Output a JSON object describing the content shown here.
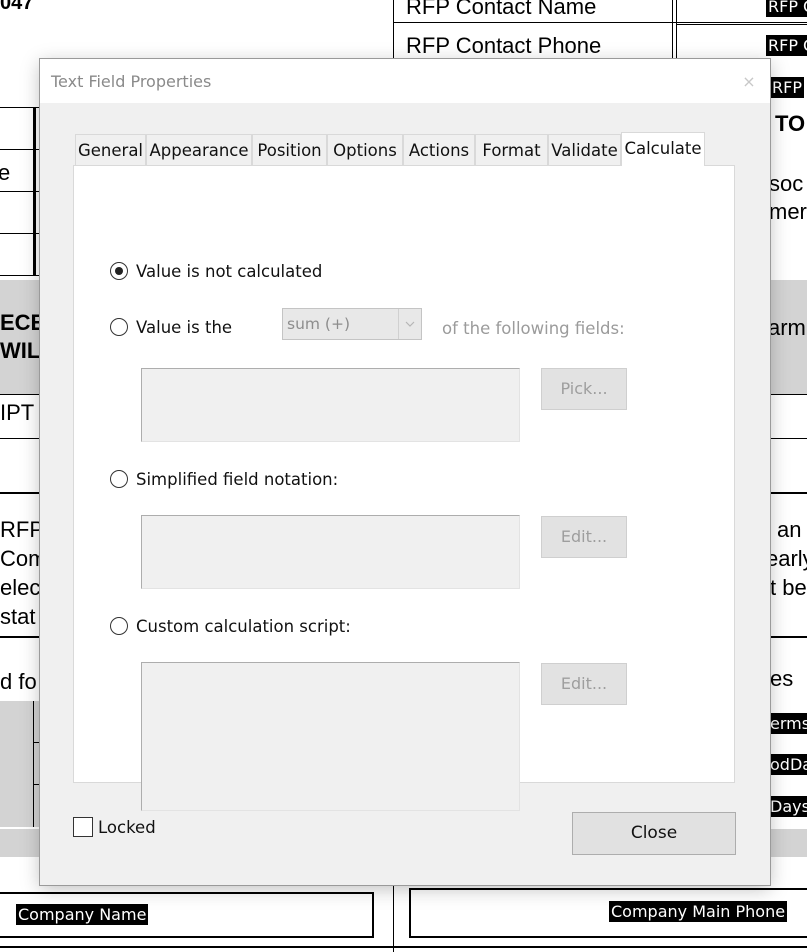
{
  "background_doc": {
    "top_left_number": "047",
    "rfp_contact_name": "RFP Contact Name",
    "rfp_contact_phone": "RFP Contact Phone",
    "field_rfp_1": "RFP C",
    "field_rfp_2": "RFP C",
    "field_rfp_3": "RFP",
    "right_to": "TO",
    "right_soc": "soc",
    "right_mer": "mer",
    "right_arm": "arm",
    "right_an": "l an",
    "right_early": "early",
    "right_tbe": "t be",
    "right_es": "es",
    "field_erms": "erms",
    "field_odda": "odDa",
    "field_days": "Days",
    "left_e": "e",
    "left_ece": "ECE",
    "left_will": "WILL",
    "left_ipt": "IPT",
    "left_rfp": "RFP",
    "left_com": "Com",
    "left_elect": "elect",
    "left_stat": "stat",
    "left_dfo": "d fo",
    "company_name": "Company Name",
    "company_main_phone": "Company Main Phone"
  },
  "dialog": {
    "title": "Text Field Properties",
    "close_glyph": "×",
    "tabs": [
      {
        "label": "General"
      },
      {
        "label": "Appearance"
      },
      {
        "label": "Position"
      },
      {
        "label": "Options"
      },
      {
        "label": "Actions"
      },
      {
        "label": "Format"
      },
      {
        "label": "Validate"
      },
      {
        "label": "Calculate",
        "active": true
      }
    ],
    "calculate": {
      "option_not_calculated": "Value is not calculated",
      "option_value_is_the": "Value is the",
      "operation_select_value": "sum (+)",
      "of_following_fields": "of the following fields:",
      "pick_button": "Pick...",
      "option_simplified": "Simplified field notation:",
      "edit_button_1": "Edit...",
      "option_custom_script": "Custom calculation script:",
      "edit_button_2": "Edit...",
      "selected_option": "not_calculated"
    },
    "locked_label": "Locked",
    "locked_checked": false,
    "close_button": "Close"
  },
  "colors": {
    "dialog_bg": "#f0f0f0",
    "panel_bg": "#ffffff",
    "disabled_text": "#9b9b9b",
    "highlight_field": "#000000"
  }
}
